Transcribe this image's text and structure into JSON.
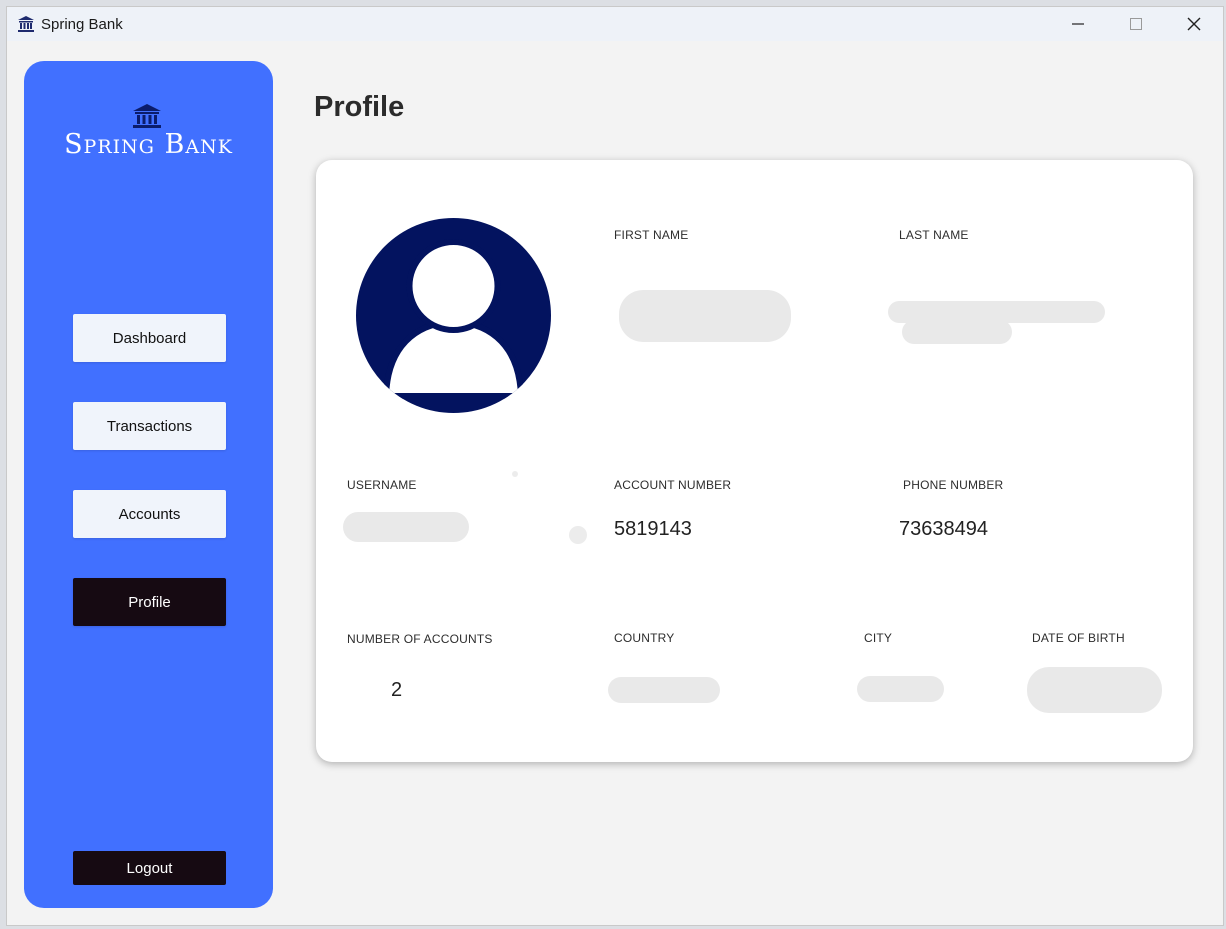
{
  "window": {
    "title": "Spring Bank"
  },
  "sidebar": {
    "brand": "Spring Bank",
    "nav": [
      {
        "label": "Dashboard",
        "active": false
      },
      {
        "label": "Transactions",
        "active": false
      },
      {
        "label": "Accounts",
        "active": false
      },
      {
        "label": "Profile",
        "active": true
      }
    ],
    "logout_label": "Logout"
  },
  "main": {
    "title": "Profile",
    "fields": {
      "first_name": {
        "label": "FIRST NAME",
        "value": "",
        "redacted": true
      },
      "last_name": {
        "label": "LAST NAME",
        "value": "",
        "redacted": true
      },
      "username": {
        "label": "USERNAME",
        "value": "",
        "redacted": true
      },
      "account_number": {
        "label": "ACCOUNT NUMBER",
        "value": "5819143"
      },
      "phone_number": {
        "label": "PHONE NUMBER",
        "value": "73638494"
      },
      "number_of_accounts": {
        "label": "NUMBER OF ACCOUNTS",
        "value": "2"
      },
      "country": {
        "label": "COUNTRY",
        "value": "",
        "redacted": true
      },
      "city": {
        "label": "CITY",
        "value": "",
        "redacted": true
      },
      "date_of_birth": {
        "label": "DATE OF BIRTH",
        "value": "",
        "redacted": true
      }
    }
  },
  "icons": {
    "app": "bank-icon",
    "avatar": "user-avatar-icon",
    "window_controls": [
      "minimize-icon",
      "maximize-icon",
      "close-icon"
    ]
  },
  "colors": {
    "sidebar": "#4170ff",
    "active_button": "#160a12",
    "avatar": "#03135f",
    "background": "#f3f3f3"
  }
}
